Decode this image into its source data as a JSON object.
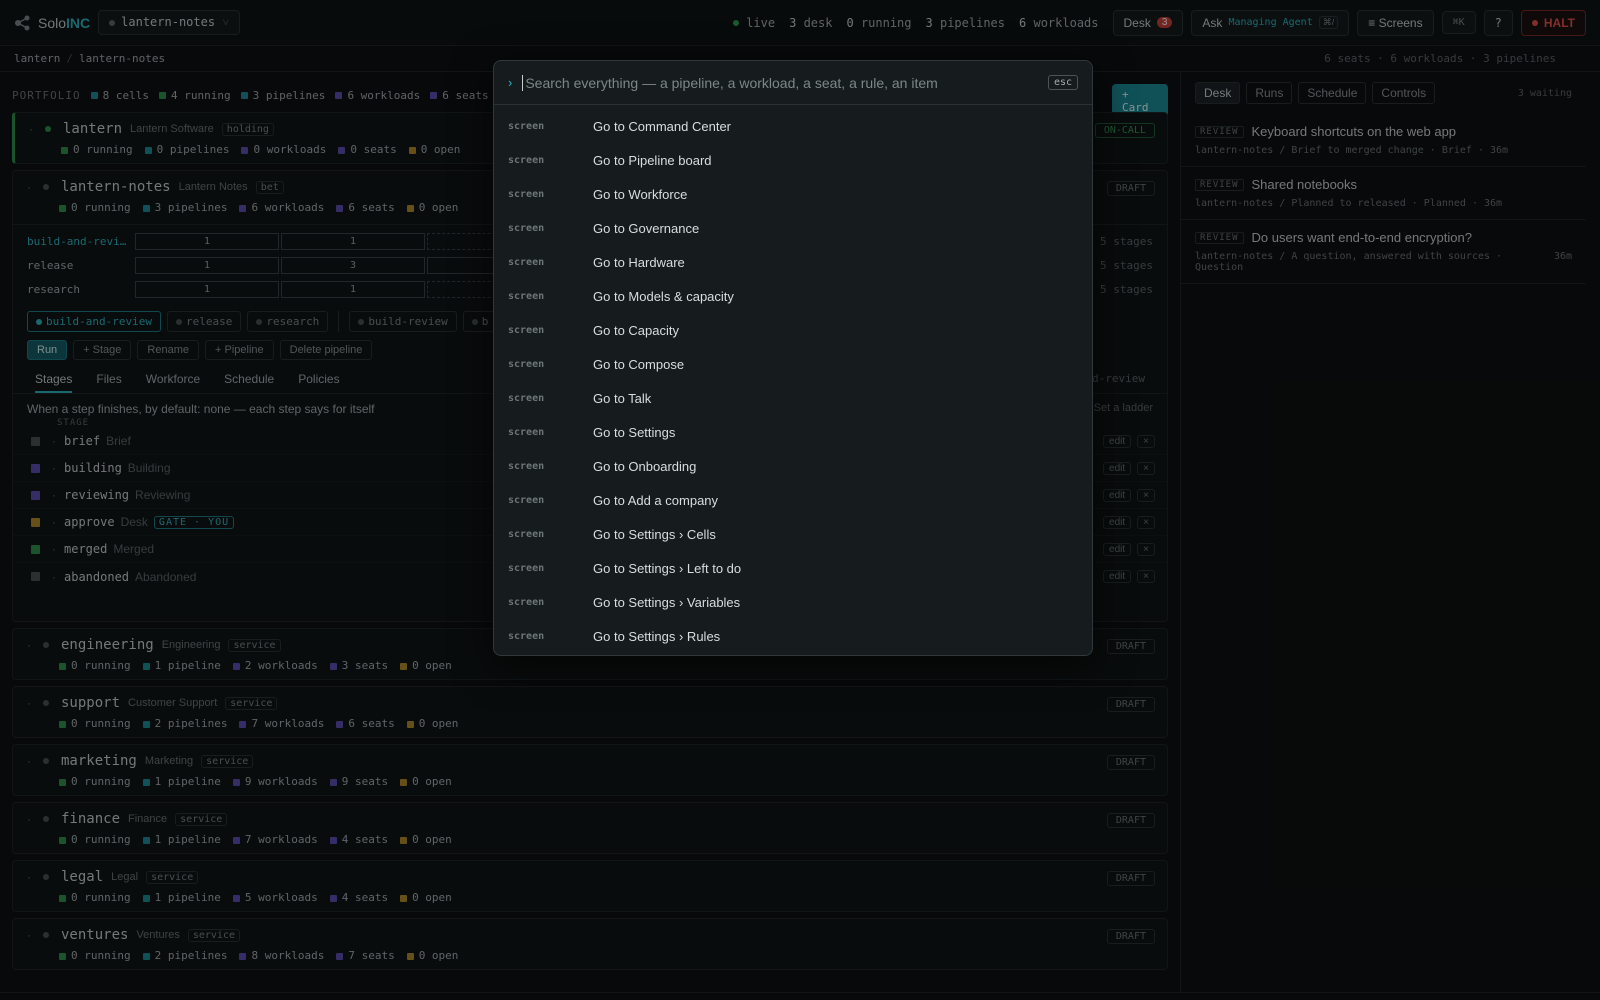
{
  "topbar": {
    "logo_solo": "Solo",
    "logo_inc": "INC",
    "workspace": "lantern-notes",
    "status_live": "live",
    "stats": [
      {
        "value": "3",
        "label": "desk"
      },
      {
        "value": "0",
        "label": "running"
      },
      {
        "value": "3",
        "label": "pipelines"
      },
      {
        "value": "6",
        "label": "workloads"
      }
    ],
    "desk_label": "Desk",
    "desk_count": "3",
    "ask_label": "Ask",
    "ask_agent": "Managing Agent",
    "ask_kbd": "⌘/",
    "screens_label": "≡ Screens",
    "cmdk": "⌘K",
    "help": "?",
    "halt": "HALT"
  },
  "breadcrumb": {
    "root": "lantern",
    "current": "lantern-notes",
    "summary": "6 seats · 6 workloads · 3 pipelines"
  },
  "portfolio": {
    "label": "PORTFOLIO",
    "stats": [
      "8 cells",
      "4 running",
      "3 pipelines",
      "6 workloads",
      "6 seats"
    ],
    "add_card": "+ Card"
  },
  "cards": [
    {
      "name": "lantern",
      "sub": "Lantern Software",
      "tag": "holding",
      "stats": [
        "0 running",
        "0 pipelines",
        "0 workloads",
        "0 seats",
        "0 open"
      ],
      "state": "ON-CALL"
    },
    {
      "name": "lantern-notes",
      "sub": "Lantern Notes",
      "tag": "bet",
      "stats": [
        "0 running",
        "3 pipelines",
        "6 workloads",
        "6 seats",
        "0 open"
      ],
      "state": "DRAFT"
    },
    {
      "name": "engineering",
      "sub": "Engineering",
      "tag": "service",
      "stats": [
        "0 running",
        "1 pipeline",
        "2 workloads",
        "3 seats",
        "0 open"
      ],
      "state": "DRAFT"
    },
    {
      "name": "support",
      "sub": "Customer Support",
      "tag": "service",
      "stats": [
        "0 running",
        "2 pipelines",
        "7 workloads",
        "6 seats",
        "0 open"
      ],
      "state": "DRAFT"
    },
    {
      "name": "marketing",
      "sub": "Marketing",
      "tag": "service",
      "stats": [
        "0 running",
        "1 pipeline",
        "9 workloads",
        "9 seats",
        "0 open"
      ],
      "state": "DRAFT"
    },
    {
      "name": "finance",
      "sub": "Finance",
      "tag": "service",
      "stats": [
        "0 running",
        "1 pipeline",
        "7 workloads",
        "4 seats",
        "0 open"
      ],
      "state": "DRAFT"
    },
    {
      "name": "legal",
      "sub": "Legal",
      "tag": "service",
      "stats": [
        "0 running",
        "1 pipeline",
        "5 workloads",
        "4 seats",
        "0 open"
      ],
      "state": "DRAFT"
    },
    {
      "name": "ventures",
      "sub": "Ventures",
      "tag": "service",
      "stats": [
        "0 running",
        "2 pipelines",
        "8 workloads",
        "7 seats",
        "0 open"
      ],
      "state": "DRAFT"
    }
  ],
  "pipelines": [
    {
      "name": "build-and-revi…",
      "cells": [
        "1",
        "1"
      ],
      "stages": "5 stages"
    },
    {
      "name": "release",
      "cells": [
        "1",
        "3"
      ],
      "stages": "5 stages"
    },
    {
      "name": "research",
      "cells": [
        "1",
        "1"
      ],
      "stages": "5 stages"
    }
  ],
  "pipeline_tabs": [
    "build-and-review",
    "release",
    "research",
    "build-review",
    "b"
  ],
  "actions": [
    "Run",
    "+ Stage",
    "Rename",
    "+ Pipeline",
    "Delete pipeline"
  ],
  "subtabs": [
    "Stages",
    "Files",
    "Workforce",
    "Schedule",
    "Policies"
  ],
  "subtab_right": "and-review",
  "default_line": "When a step finishes, by default:  none — each step says for itself",
  "set_ladder": "Set a ladder",
  "stage_header": "STAGE",
  "stages": [
    {
      "id": "brief",
      "label": "Brief",
      "color": "#4a5254"
    },
    {
      "id": "building",
      "label": "Building",
      "color": "#5a4fb0"
    },
    {
      "id": "reviewing",
      "label": "Reviewing",
      "color": "#5a4fb0"
    },
    {
      "id": "approve",
      "label": "Desk",
      "color": "#b08a2a",
      "gate": "GATE · YOU"
    },
    {
      "id": "merged",
      "label": "Merged",
      "color": "#2f8f4c"
    },
    {
      "id": "abandoned",
      "label": "Abandoned",
      "color": "#4a5254"
    }
  ],
  "stage_edit": "edit",
  "stage_remove": "×",
  "right_panel": {
    "tabs": [
      "Desk",
      "Runs",
      "Schedule",
      "Controls"
    ],
    "waiting": "3 waiting",
    "review_tag": "REVIEW",
    "items": [
      {
        "title": "Keyboard shortcuts on the web app",
        "sub": "lantern-notes / Brief to merged change · Brief",
        "age": "· 36m"
      },
      {
        "title": "Shared notebooks",
        "sub": "lantern-notes / Planned to released · Planned",
        "age": "· 36m"
      },
      {
        "title": "Do users want end-to-end encryption?",
        "sub": "lantern-notes / A question, answered with sources · Question",
        "age": "36m"
      }
    ]
  },
  "palette": {
    "prompt": "›",
    "placeholder": "Search everything — a pipeline, a workload, a seat, a rule, an item",
    "esc": "esc",
    "kind": "screen",
    "items": [
      "Go to Command Center",
      "Go to Pipeline board",
      "Go to Workforce",
      "Go to Governance",
      "Go to Hardware",
      "Go to Models & capacity",
      "Go to Capacity",
      "Go to Compose",
      "Go to Talk",
      "Go to Settings",
      "Go to Onboarding",
      "Go to Add a company",
      "Go to Settings › Cells",
      "Go to Settings › Left to do",
      "Go to Settings › Variables",
      "Go to Settings › Rules"
    ]
  }
}
